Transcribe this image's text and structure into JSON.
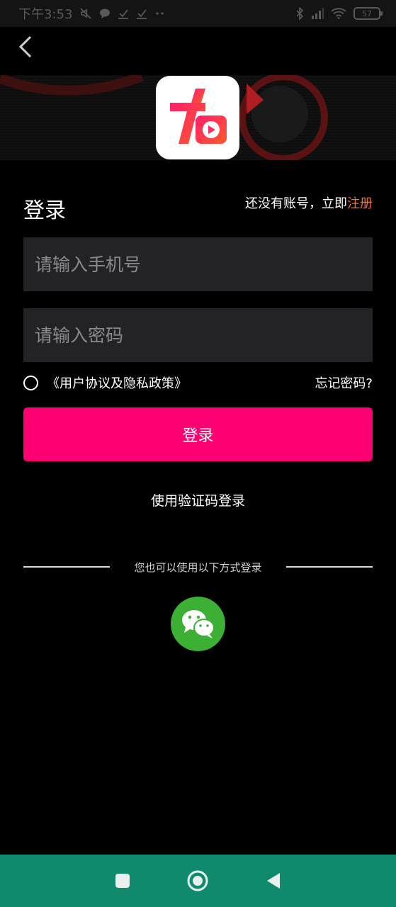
{
  "status_bar": {
    "time": "下午3:53",
    "battery": "57"
  },
  "header": {
    "title": "登录",
    "register_prompt": "还没有账号，立即",
    "register_link": "注册"
  },
  "form": {
    "phone_placeholder": "请输入手机号",
    "password_placeholder": "请输入密码",
    "agreement": "《用户协议及隐私政策》",
    "forgot_password": "忘记密码?",
    "login_button": "登录",
    "sms_login": "使用验证码登录"
  },
  "alt_login": {
    "divider_text": "您也可以使用以下方式登录"
  },
  "colors": {
    "accent": "#ff0072",
    "link": "#ff6a2a",
    "wechat": "#3cb035",
    "navbar": "#0f8a6c"
  },
  "icons": [
    "back-icon",
    "wechat-icon",
    "square-nav-icon",
    "home-nav-icon",
    "back-nav-icon"
  ]
}
